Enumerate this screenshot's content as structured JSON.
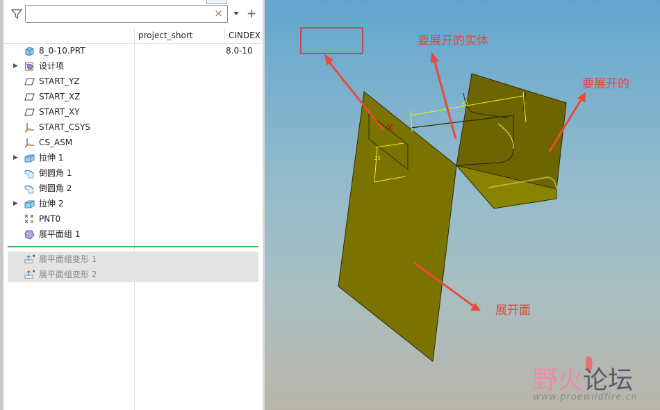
{
  "filter": {
    "placeholder": "",
    "value": ""
  },
  "columns": [
    "project_short",
    "CINDEX"
  ],
  "tree": [
    {
      "label": "8_0-10.PRT",
      "value": "8.0-10",
      "icon": "part-icon",
      "expandable": false
    },
    {
      "label": "设计项",
      "icon": "design-items-icon",
      "expandable": true
    },
    {
      "label": "START_YZ",
      "icon": "datum-plane-icon",
      "expandable": false
    },
    {
      "label": "START_XZ",
      "icon": "datum-plane-icon",
      "expandable": false
    },
    {
      "label": "START_XY",
      "icon": "datum-plane-icon",
      "expandable": false
    },
    {
      "label": "START_CSYS",
      "icon": "csys-icon",
      "expandable": false
    },
    {
      "label": "CS_ASM",
      "icon": "csys-icon",
      "expandable": false
    },
    {
      "label": "拉伸 1",
      "icon": "extrude-icon",
      "expandable": true
    },
    {
      "label": "倒圆角 1",
      "icon": "round-icon",
      "expandable": false
    },
    {
      "label": "倒圆角 2",
      "icon": "round-icon",
      "expandable": false
    },
    {
      "label": "拉伸 2",
      "icon": "extrude-icon",
      "expandable": true
    },
    {
      "label": "PNT0",
      "icon": "datum-point-icon",
      "expandable": false
    },
    {
      "label": "展平面组 1",
      "icon": "flatten-quilt-icon",
      "expandable": false
    }
  ],
  "suppressed": [
    {
      "label": "展平面组变形 1",
      "icon": "flatten-deform-icon"
    },
    {
      "label": "展平面组变形 2",
      "icon": "flatten-deform-icon"
    }
  ],
  "annotations": {
    "solid": "要展开的实体",
    "surface": "要展开的",
    "flat": "展开面"
  },
  "dimensions": {
    "width": "90",
    "height": "25"
  },
  "watermark": {
    "part1": "野火",
    "part2": "论坛",
    "url": "www.proewildfire.cn"
  },
  "colors": {
    "annotation_red": "#e3453a",
    "model_olive": "#7c7400",
    "dimension_yellow": "#f0f000",
    "insert_green": "#4db34d"
  }
}
